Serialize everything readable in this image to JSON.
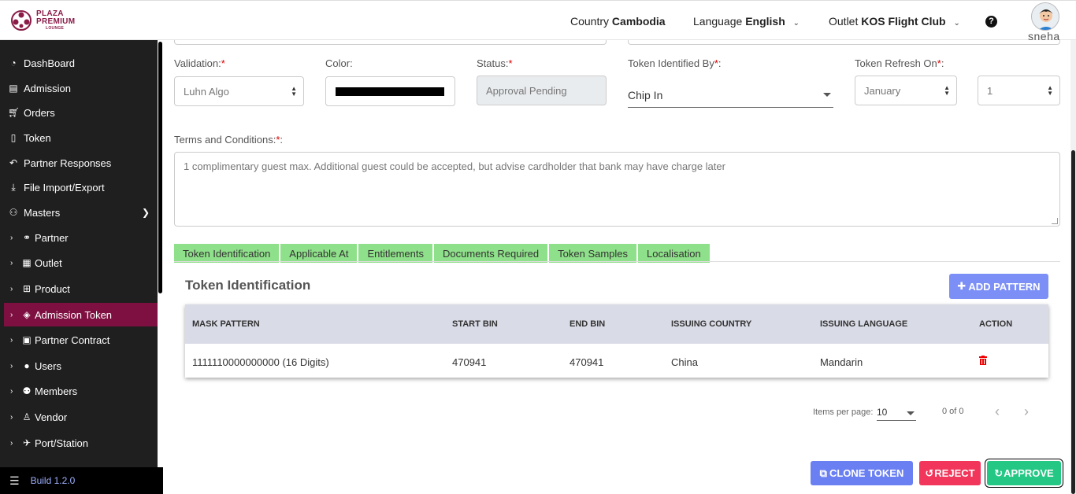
{
  "brand": {
    "line1": "PLAZA",
    "line2": "PREMIUM",
    "line3": "LOUNGE"
  },
  "header": {
    "country_label": "Country",
    "country_value": "Cambodia",
    "language_label": "Language",
    "language_value": "English",
    "outlet_label": "Outlet",
    "outlet_value": "KOS Flight Club",
    "help": "?",
    "username": "sneha"
  },
  "sidebar": {
    "items": [
      {
        "label": "DashBoard",
        "icon": "tachometer-icon"
      },
      {
        "label": "Admission",
        "icon": "id-card-icon"
      },
      {
        "label": "Orders",
        "icon": "cart-icon"
      },
      {
        "label": "Token",
        "icon": "file-icon"
      },
      {
        "label": "Partner Responses",
        "icon": "reply-icon"
      },
      {
        "label": "File Import/Export",
        "icon": "download-icon"
      },
      {
        "label": "Masters",
        "icon": "sitemap-icon"
      },
      {
        "label": "Partner",
        "icon": "handshake-icon"
      },
      {
        "label": "Outlet",
        "icon": "building-icon"
      },
      {
        "label": "Product",
        "icon": "gift-icon"
      },
      {
        "label": "Admission Token",
        "icon": "ticket-icon"
      },
      {
        "label": "Partner Contract",
        "icon": "briefcase-icon"
      },
      {
        "label": "Users",
        "icon": "user-icon"
      },
      {
        "label": "Members",
        "icon": "users-icon"
      },
      {
        "label": "Vendor",
        "icon": "person-icon"
      },
      {
        "label": "Port/Station",
        "icon": "plane-icon"
      }
    ],
    "build": "Build 1.2.0"
  },
  "form": {
    "validation_label": "Validation:",
    "validation_value": "Luhn Algo",
    "color_label": "Color:",
    "color_value": "#000000",
    "status_label": "Status:",
    "status_value": "Approval Pending",
    "identified_label": "Token Identified By",
    "identified_value": "Chip In",
    "refresh_label": "Token Refresh On",
    "refresh_month": "January",
    "refresh_day": "1",
    "terms_label": "Terms and Conditions:",
    "terms_value": "1 complimentary guest max. Additional guest could be accepted, but advise cardholder that bank may have charge later",
    "required_mark": "*"
  },
  "tabs": [
    "Token Identification",
    "Applicable At",
    "Entitlements",
    "Documents Required",
    "Token Samples",
    "Localisation"
  ],
  "token_identification": {
    "title": "Token Identification",
    "add_button": "ADD PATTERN",
    "columns": [
      "MASK PATTERN",
      "START BIN",
      "END BIN",
      "ISSUING COUNTRY",
      "ISSUING LANGUAGE",
      "ACTION"
    ],
    "rows": [
      {
        "mask": "1111110000000000 (16 Digits)",
        "start": "470941",
        "end": "470941",
        "country": "China",
        "language": "Mandarin"
      }
    ]
  },
  "pager": {
    "items_label": "Items per page:",
    "per_page": "10",
    "range": "0 of 0"
  },
  "actions": {
    "clone": "CLONE TOKEN",
    "reject": "REJECT",
    "approve": "APPROVE"
  },
  "colors": {
    "sidebar_bg": "#1f1f1f",
    "active_item": "#7d1040",
    "tab_green": "#8fe08a",
    "add_btn": "#7c8ff7",
    "reject": "#f2355a",
    "approve": "#24c784",
    "clone": "#6a7ff2"
  }
}
